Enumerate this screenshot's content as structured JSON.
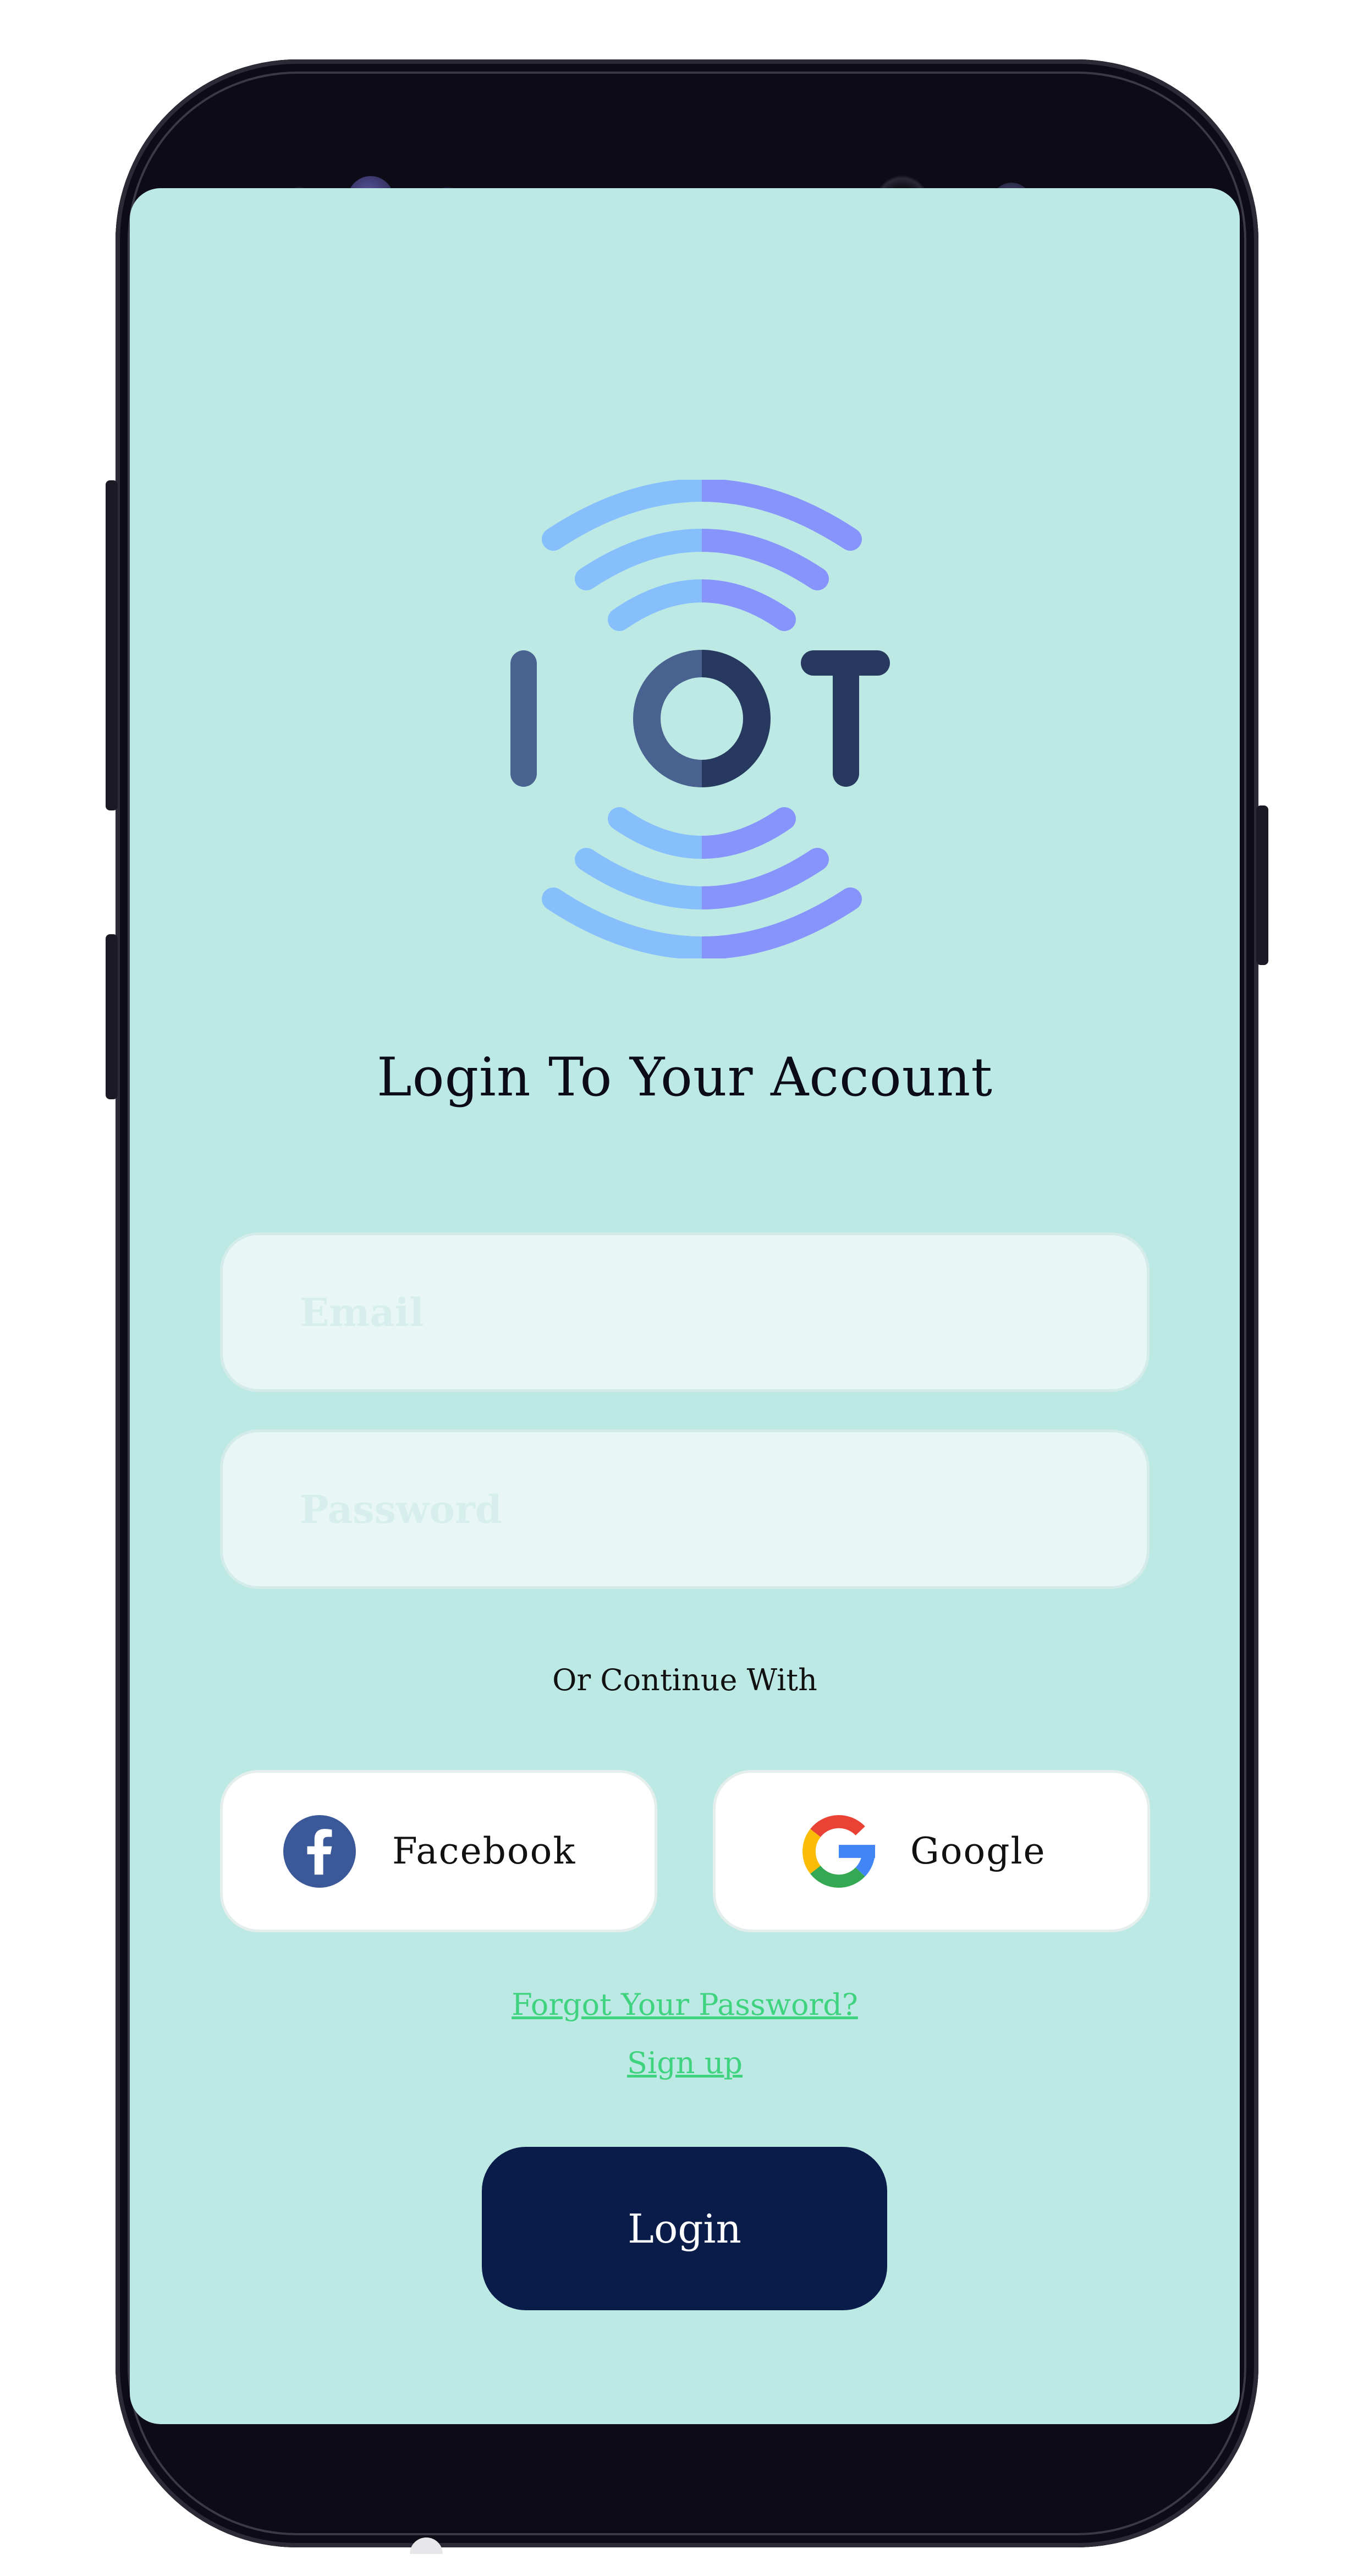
{
  "logo": {
    "text": "IOT"
  },
  "title": "Login To Your Account",
  "email_field": {
    "placeholder": "Email",
    "value": ""
  },
  "password_field": {
    "placeholder": "Password",
    "value": ""
  },
  "or_continue_with": "Or Continue With",
  "social": {
    "facebook_label": "Facebook",
    "google_label": "Google"
  },
  "links": {
    "forgot_password": "Forgot Your Password?",
    "sign_up": "Sign up"
  },
  "login_button": "Login",
  "colors": {
    "screen_background": "#bde9e5",
    "login_button": "#0a1c4a",
    "link": "#3fd37f",
    "logo_wave_left": "#86bffc",
    "logo_wave_right": "#8694fb",
    "logo_letters_left": "#4a6290",
    "logo_letters_right": "#27395e",
    "facebook_blue": "#3b5998"
  },
  "icons": [
    "iot-logo-icon",
    "facebook-icon",
    "google-icon"
  ]
}
